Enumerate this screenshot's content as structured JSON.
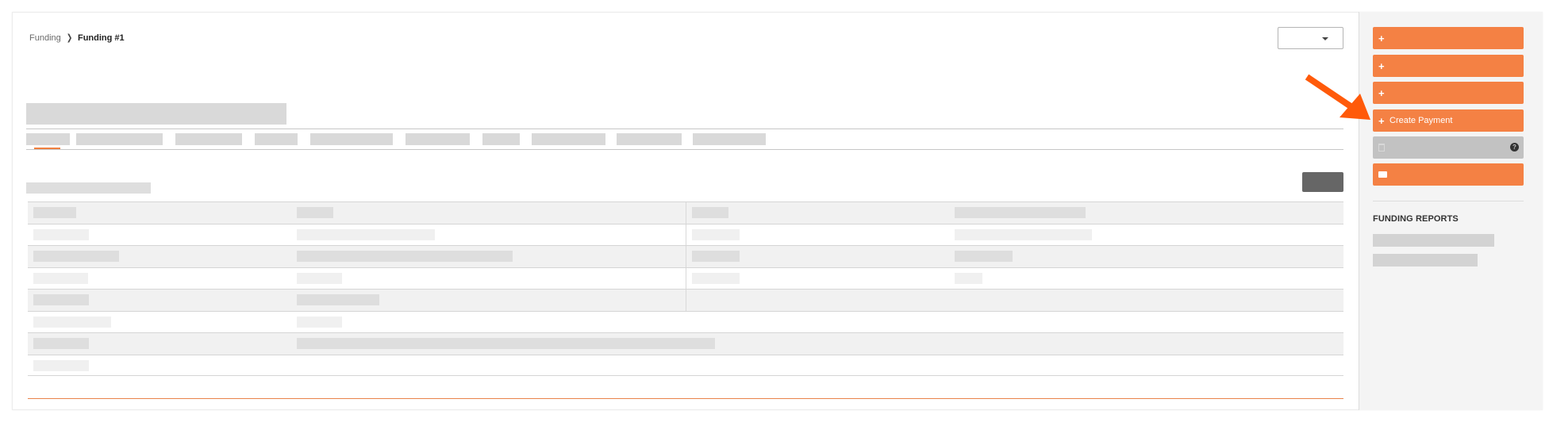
{
  "breadcrumb": {
    "root": "Funding",
    "separator_icon": "chevron-right-icon",
    "current": "Funding #1"
  },
  "header": {
    "dropdown_value": "",
    "dropdown_icon": "caret-down-icon"
  },
  "tabs": {
    "count": 10,
    "active_index": 0
  },
  "sidebar": {
    "buttons": [
      {
        "icon": "plus-icon",
        "label": "",
        "state": "enabled"
      },
      {
        "icon": "plus-icon",
        "label": "",
        "state": "enabled"
      },
      {
        "icon": "plus-icon",
        "label": "",
        "state": "enabled"
      },
      {
        "icon": "plus-icon",
        "label": "Create Payment",
        "state": "enabled"
      },
      {
        "icon": "trash-icon",
        "label": "",
        "state": "disabled",
        "help_icon": "question-circle-icon"
      },
      {
        "icon": "envelope-icon",
        "label": "",
        "state": "enabled"
      }
    ],
    "reports_heading": "FUNDING REPORTS"
  },
  "annotation": {
    "arrow_icon": "arrow-pointer-icon",
    "arrow_color": "#ff5a0a",
    "points_to": "Create Payment"
  },
  "colors": {
    "accent": "#f48144",
    "disabled": "#c2c2c2",
    "skeleton": "#d9d9d9",
    "dark_button": "#666666"
  }
}
